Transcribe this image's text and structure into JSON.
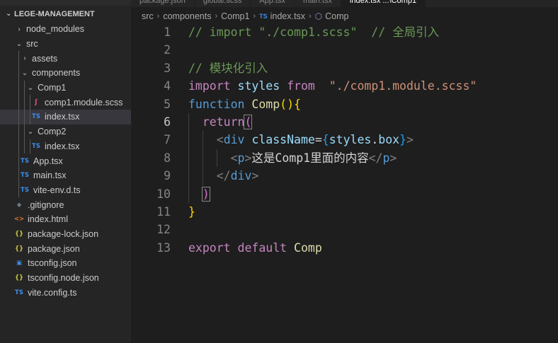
{
  "sidebar": {
    "project": "LEGE-MANAGEMENT",
    "items": [
      {
        "label": "node_modules",
        "kind": "folder",
        "open": false,
        "depth": 0
      },
      {
        "label": "src",
        "kind": "folder",
        "open": true,
        "depth": 0
      },
      {
        "label": "assets",
        "kind": "folder",
        "open": false,
        "depth": 1
      },
      {
        "label": "components",
        "kind": "folder",
        "open": true,
        "depth": 1
      },
      {
        "label": "Comp1",
        "kind": "folder",
        "open": true,
        "depth": 2
      },
      {
        "label": "comp1.module.scss",
        "kind": "scss",
        "icon": "sass-icon",
        "depth": 3
      },
      {
        "label": "index.tsx",
        "kind": "ts",
        "icon": "ts-icon",
        "depth": 3,
        "selected": true
      },
      {
        "label": "Comp2",
        "kind": "folder",
        "open": true,
        "depth": 2
      },
      {
        "label": "index.tsx",
        "kind": "ts",
        "icon": "ts-icon",
        "depth": 3
      },
      {
        "label": "App.tsx",
        "kind": "ts",
        "icon": "ts-icon",
        "depth": 1
      },
      {
        "label": "main.tsx",
        "kind": "ts",
        "icon": "ts-icon",
        "depth": 1
      },
      {
        "label": "vite-env.d.ts",
        "kind": "ts",
        "icon": "ts-icon",
        "depth": 1
      },
      {
        "label": ".gitignore",
        "kind": "git",
        "icon": "git-icon",
        "depth": 0
      },
      {
        "label": "index.html",
        "kind": "html",
        "icon": "html-icon",
        "depth": 0
      },
      {
        "label": "package-lock.json",
        "kind": "json",
        "icon": "json-icon",
        "depth": 0
      },
      {
        "label": "package.json",
        "kind": "json",
        "icon": "json-icon",
        "depth": 0
      },
      {
        "label": "tsconfig.json",
        "kind": "tsconfig",
        "icon": "tsconfig-icon",
        "depth": 0
      },
      {
        "label": "tsconfig.node.json",
        "kind": "json",
        "icon": "json-icon",
        "depth": 0
      },
      {
        "label": "vite.config.ts",
        "kind": "ts",
        "icon": "ts-icon",
        "depth": 0
      }
    ]
  },
  "tabs": [
    {
      "label": "package.json",
      "active": false
    },
    {
      "label": "global.scss",
      "active": false
    },
    {
      "label": "App.tsx",
      "active": false
    },
    {
      "label": "main.tsx",
      "active": false
    },
    {
      "label": "index.tsx ...\\Comp1",
      "active": true
    }
  ],
  "breadcrumb": {
    "segments": [
      "src",
      "components",
      "Comp1"
    ],
    "file_badge": "TS",
    "file": "index.tsx",
    "symbol": "Comp"
  },
  "editor": {
    "active_line": 6,
    "lines": [
      {
        "n": "1",
        "tokens": [
          [
            "cm",
            "// import \"./comp1.scss\"  // 全局引入"
          ]
        ]
      },
      {
        "n": "2",
        "tokens": []
      },
      {
        "n": "3",
        "tokens": [
          [
            "cm",
            "// 模块化引入"
          ]
        ]
      },
      {
        "n": "4",
        "tokens": [
          [
            "kw",
            "import"
          ],
          [
            "txt",
            " "
          ],
          [
            "var",
            "styles"
          ],
          [
            "txt",
            " "
          ],
          [
            "kw",
            "from"
          ],
          [
            "txt",
            "  "
          ],
          [
            "str",
            "\"./comp1.module.scss\""
          ]
        ]
      },
      {
        "n": "5",
        "tokens": [
          [
            "bl",
            "function"
          ],
          [
            "txt",
            " "
          ],
          [
            "fn",
            "Comp"
          ],
          [
            "br1",
            "()"
          ],
          [
            "br1",
            "{"
          ]
        ]
      },
      {
        "n": "6",
        "tokens": [
          [
            "txt",
            "  "
          ],
          [
            "kw",
            "return"
          ],
          [
            "br2 bm",
            "("
          ]
        ]
      },
      {
        "n": "7",
        "tokens": [
          [
            "txt",
            "    "
          ],
          [
            "punc",
            "<"
          ],
          [
            "tag",
            "div"
          ],
          [
            "txt",
            " "
          ],
          [
            "var",
            "className"
          ],
          [
            "txt",
            "="
          ],
          [
            "br3",
            "{"
          ],
          [
            "var",
            "styles"
          ],
          [
            "txt",
            "."
          ],
          [
            "var",
            "box"
          ],
          [
            "br3",
            "}"
          ],
          [
            "punc",
            ">"
          ]
        ]
      },
      {
        "n": "8",
        "tokens": [
          [
            "txt",
            "      "
          ],
          [
            "punc",
            "<"
          ],
          [
            "tag",
            "p"
          ],
          [
            "punc",
            ">"
          ],
          [
            "txt",
            "这是Comp1里面的内容"
          ],
          [
            "punc",
            "</"
          ],
          [
            "tag",
            "p"
          ],
          [
            "punc",
            ">"
          ]
        ]
      },
      {
        "n": "9",
        "tokens": [
          [
            "txt",
            "    "
          ],
          [
            "punc",
            "</"
          ],
          [
            "tag",
            "div"
          ],
          [
            "punc",
            ">"
          ]
        ]
      },
      {
        "n": "10",
        "tokens": [
          [
            "txt",
            "  "
          ],
          [
            "br2 bm",
            ")"
          ]
        ]
      },
      {
        "n": "11",
        "tokens": [
          [
            "br1",
            "}"
          ]
        ]
      },
      {
        "n": "12",
        "tokens": []
      },
      {
        "n": "13",
        "tokens": [
          [
            "kw",
            "export"
          ],
          [
            "txt",
            " "
          ],
          [
            "kw",
            "default"
          ],
          [
            "txt",
            " "
          ],
          [
            "fn",
            "Comp"
          ]
        ]
      }
    ]
  },
  "colors": {
    "sidebar_bg": "#252526",
    "editor_bg": "#1e1e1e",
    "selected_row": "#37373d",
    "ts_icon": "#3b8eea",
    "scss_icon": "#f55385",
    "json_icon": "#cbcb41",
    "html_icon": "#e37933",
    "git_icon": "#41535b"
  }
}
